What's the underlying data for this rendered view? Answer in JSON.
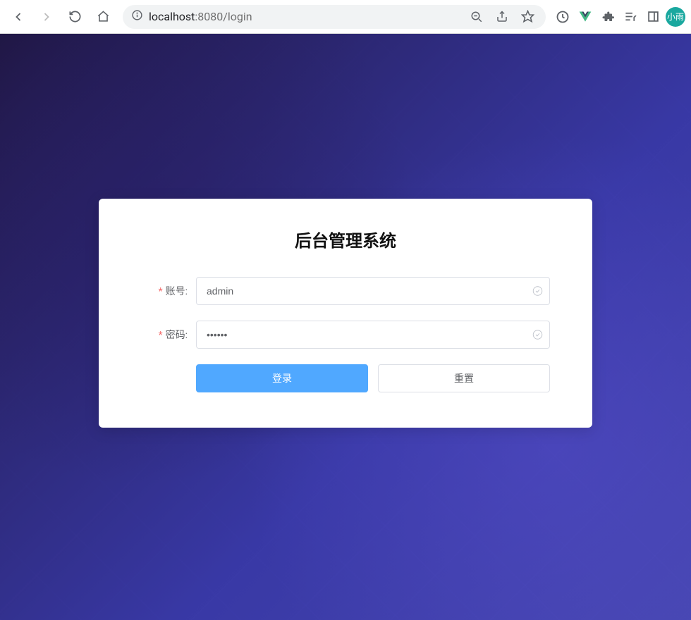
{
  "browser": {
    "url_host": "localhost",
    "url_port": ":8080",
    "url_path": "/login",
    "avatar_label": "小雨"
  },
  "login": {
    "title": "后台管理系统",
    "username_label": "账号:",
    "password_label": "密码:",
    "username_value": "admin",
    "password_value": "••••••",
    "submit_label": "登录",
    "reset_label": "重置"
  }
}
